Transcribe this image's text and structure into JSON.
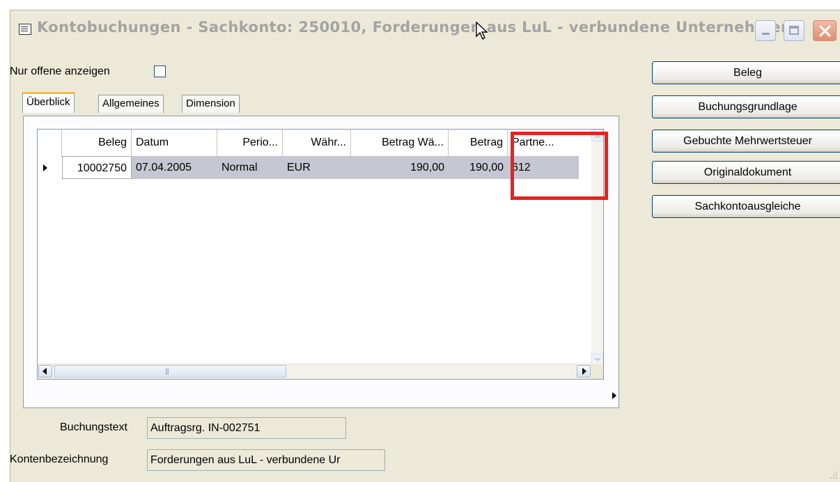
{
  "window": {
    "title": "Kontobuchungen - Sachkonto: 250010, Forderungen aus LuL - verbundene Unternehmen"
  },
  "filter": {
    "label": "Nur offene anzeigen",
    "checked": false
  },
  "tabs": [
    {
      "label": "Überblick",
      "active": true
    },
    {
      "label": "Allgemeines",
      "active": false
    },
    {
      "label": "Dimension",
      "active": false
    }
  ],
  "grid": {
    "columns": [
      "Beleg",
      "Datum",
      "Perio...",
      "Währ...",
      "Betrag Wä...",
      "Betrag",
      "Partne..."
    ],
    "rows": [
      [
        "10002750",
        "07.04.2005",
        "Normal",
        "EUR",
        "190,00",
        "190,00",
        "612"
      ]
    ]
  },
  "buttons": {
    "beleg": "Beleg",
    "buchungsgrundlage": "Buchungsgrundlage",
    "mehrwertsteuer": "Gebuchte Mehrwertsteuer",
    "originaldokument": "Originaldokument",
    "ausgleiche": "Sachkontoausgleiche"
  },
  "fields": {
    "buchungstext_label": "Buchungstext",
    "buchungstext_value": "Auftragsrg. IN-002751",
    "kontenbezeichnung_label": "Kontenbezeichnung",
    "kontenbezeichnung_value": "Forderungen aus LuL - verbundene Ur"
  },
  "colors": {
    "window_bg": "#ece9d8",
    "highlight": "#e52321",
    "row_bg": "#c6c7d2",
    "tab_accent": "#f5bd46"
  }
}
